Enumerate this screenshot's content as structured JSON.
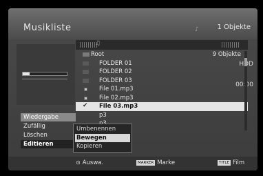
{
  "window": {
    "title": "Musikliste",
    "object_count": "1 Objekte"
  },
  "device": {
    "label": "HDD",
    "time": "00:00",
    "usage_fraction": 0.15
  },
  "list": {
    "header_count": "9 Objekte",
    "rows": [
      {
        "type": "up",
        "name": "Root",
        "right": "9 Objekte"
      },
      {
        "type": "folder",
        "name": "FOLDER 01"
      },
      {
        "type": "folder",
        "name": "FOLDER 02"
      },
      {
        "type": "folder",
        "name": "FOLDER 03"
      },
      {
        "type": "file",
        "name": "File 01.mp3"
      },
      {
        "type": "file",
        "name": "File 02.mp3"
      },
      {
        "type": "check",
        "name": "File 03.mp3",
        "selected": true
      },
      {
        "type": "none",
        "name": "p3"
      },
      {
        "type": "none",
        "name": "p3"
      },
      {
        "type": "none",
        "name": "p3"
      }
    ]
  },
  "left_menu": [
    "Wiedergabe",
    "Zufällig",
    "Löschen",
    "Editieren"
  ],
  "submenu": [
    "Umbenennen",
    "Bewegen",
    "Kopieren"
  ],
  "footer": {
    "select": "Auswa.",
    "marker_badge": "MARKER",
    "marker_label": "Marke",
    "title_badge": "TITLE",
    "title_label": "Film"
  },
  "colors": {
    "selection": "#e4e4e4",
    "background": "#3c3c3c"
  }
}
